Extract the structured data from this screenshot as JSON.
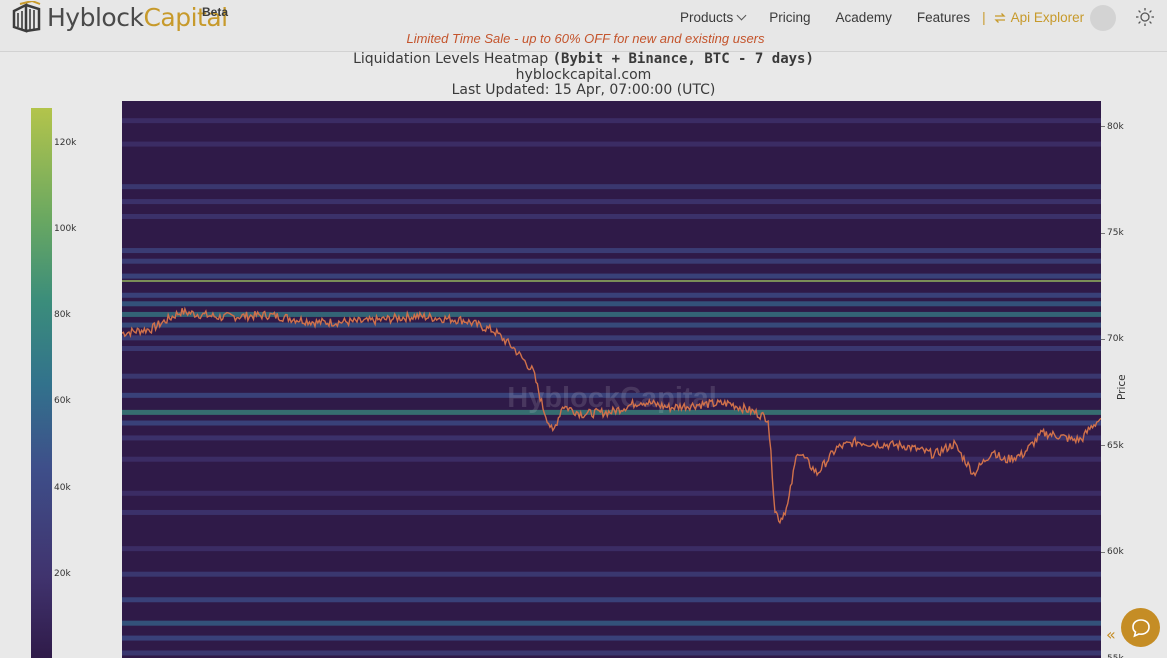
{
  "brand": {
    "name_part1": "Hyblock",
    "name_part2": "Capital",
    "badge": "Beta"
  },
  "nav": {
    "products": "Products",
    "pricing": "Pricing",
    "academy": "Academy",
    "features": "Features",
    "separator": "|",
    "api_explorer": "Api Explorer"
  },
  "promo": "Limited Time Sale - up to 60% OFF for new and existing users",
  "chart_header": {
    "line1_prefix": "Liquidation Levels Heatmap",
    "line1_bold": "(Bybit + Binance, BTC - 7 days)",
    "line2": "hyblockcapital.com",
    "line3": "Last Updated: 15 Apr, 07:00:00 (UTC)"
  },
  "watermark": "HyblockCapital",
  "colors": {
    "accent": "#c79a2b",
    "promo": "#c4542c",
    "heatmap_bg": "#2f1a48",
    "price_line": "#d0714b"
  },
  "icons": {
    "logo": "hyblock-logo-icon",
    "api": "swap-icon",
    "theme": "sun-icon",
    "chat": "chat-bubble-icon",
    "collapse": "double-chevron-left-icon"
  },
  "chart_data": {
    "type": "heatmap",
    "title": "Liquidation Levels Heatmap (Bybit + Binance, BTC - 7 days)",
    "subtitle": "hyblockcapital.com",
    "updated": "Last Updated: 15 Apr, 07:00:00 (UTC)",
    "ylabel": "Price",
    "ylim": [
      54900,
      81200
    ],
    "yticks": [
      80000,
      75000,
      70000,
      65000,
      60000,
      55000
    ],
    "ytick_labels": [
      "80k",
      "75k",
      "70k",
      "65k",
      "60k",
      "55k"
    ],
    "colorbar": {
      "range": [
        0,
        128000
      ],
      "ticks": [
        120000,
        100000,
        80000,
        60000,
        40000,
        20000
      ],
      "tick_labels": [
        "120k",
        "100k",
        "80k",
        "60k",
        "40k",
        "20k"
      ]
    },
    "price_series": {
      "name": "BTC price",
      "t": [
        0,
        0.03,
        0.06,
        0.1,
        0.15,
        0.2,
        0.25,
        0.3,
        0.35,
        0.38,
        0.4,
        0.42,
        0.43,
        0.44,
        0.45,
        0.47,
        0.5,
        0.53,
        0.56,
        0.59,
        0.62,
        0.645,
        0.66,
        0.667,
        0.672,
        0.68,
        0.69,
        0.71,
        0.73,
        0.75,
        0.77,
        0.8,
        0.83,
        0.85,
        0.87,
        0.89,
        0.9,
        0.92,
        0.94,
        0.955,
        0.97,
        0.98,
        0.99,
        1.0
      ],
      "price": [
        70300,
        70500,
        71300,
        71050,
        71150,
        70800,
        70850,
        71100,
        70900,
        70400,
        69600,
        68500,
        66800,
        65600,
        66900,
        66500,
        66600,
        67100,
        66800,
        66950,
        67000,
        66600,
        66300,
        62000,
        61500,
        62200,
        64800,
        63700,
        64900,
        65200,
        65100,
        65000,
        64600,
        65100,
        63700,
        64800,
        64300,
        64600,
        65600,
        65500,
        65300,
        65300,
        65900,
        66300
      ]
    },
    "bands": [
      {
        "price": 80300,
        "intensity": 0.35
      },
      {
        "price": 79200,
        "intensity": 0.35
      },
      {
        "price": 77200,
        "intensity": 0.45
      },
      {
        "price": 76500,
        "intensity": 0.4
      },
      {
        "price": 75800,
        "intensity": 0.4
      },
      {
        "price": 74200,
        "intensity": 0.5
      },
      {
        "price": 73700,
        "intensity": 0.5
      },
      {
        "price": 73000,
        "intensity": 0.55
      },
      {
        "price": 72700,
        "intensity": 0.95
      },
      {
        "price": 72100,
        "intensity": 0.55
      },
      {
        "price": 71700,
        "intensity": 0.65
      },
      {
        "price": 71200,
        "intensity": 0.75
      },
      {
        "price": 70700,
        "intensity": 0.6
      },
      {
        "price": 70100,
        "intensity": 0.5
      },
      {
        "price": 69600,
        "intensity": 0.45
      },
      {
        "price": 68300,
        "intensity": 0.45
      },
      {
        "price": 67400,
        "intensity": 0.55
      },
      {
        "price": 66600,
        "intensity": 0.8
      },
      {
        "price": 66100,
        "intensity": 0.55
      },
      {
        "price": 65400,
        "intensity": 0.4
      },
      {
        "price": 64400,
        "intensity": 0.35
      },
      {
        "price": 62800,
        "intensity": 0.35
      },
      {
        "price": 61900,
        "intensity": 0.4
      },
      {
        "price": 60200,
        "intensity": 0.35
      },
      {
        "price": 59000,
        "intensity": 0.45
      },
      {
        "price": 57800,
        "intensity": 0.55
      },
      {
        "price": 56700,
        "intensity": 0.65
      },
      {
        "price": 56000,
        "intensity": 0.55
      },
      {
        "price": 55300,
        "intensity": 0.45
      }
    ],
    "grid": false
  }
}
